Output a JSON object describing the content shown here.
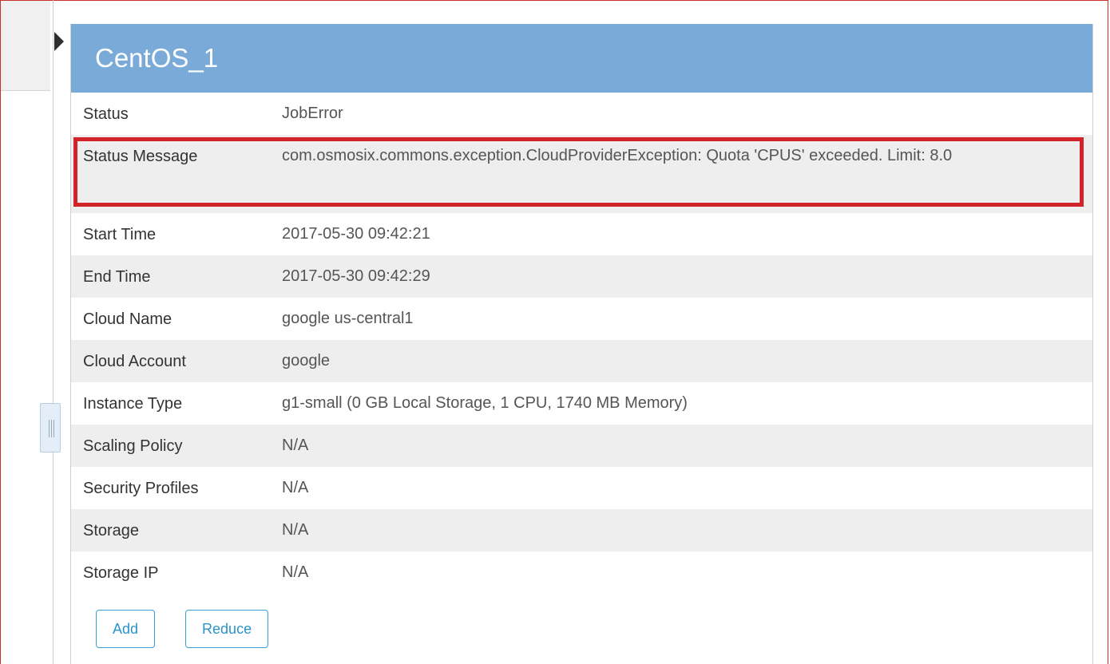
{
  "panel": {
    "title": "CentOS_1"
  },
  "details": [
    {
      "label": "Status",
      "value": "JobError"
    },
    {
      "label": "Status Message",
      "value": "com.osmosix.commons.exception.CloudProviderException: Quota 'CPUS' exceeded. Limit: 8.0"
    },
    {
      "label": "Start Time",
      "value": "2017-05-30 09:42:21"
    },
    {
      "label": "End Time",
      "value": "2017-05-30 09:42:29"
    },
    {
      "label": "Cloud Name",
      "value": "google us-central1"
    },
    {
      "label": "Cloud Account",
      "value": "google"
    },
    {
      "label": "Instance Type",
      "value": "g1-small (0 GB Local Storage, 1 CPU, 1740 MB Memory)"
    },
    {
      "label": "Scaling Policy",
      "value": "N/A"
    },
    {
      "label": "Security Profiles",
      "value": "N/A"
    },
    {
      "label": "Storage",
      "value": "N/A"
    },
    {
      "label": "Storage IP",
      "value": "N/A"
    }
  ],
  "actions": {
    "add_label": "Add",
    "reduce_label": "Reduce"
  },
  "colors": {
    "header_bg": "#7aabd8",
    "highlight_border": "#d2232a",
    "button_accent": "#2a93c7",
    "alt_row_bg": "#eeeeee"
  },
  "icons": {
    "expand": "caret-right-icon",
    "splitter": "drag-handle-icon"
  }
}
